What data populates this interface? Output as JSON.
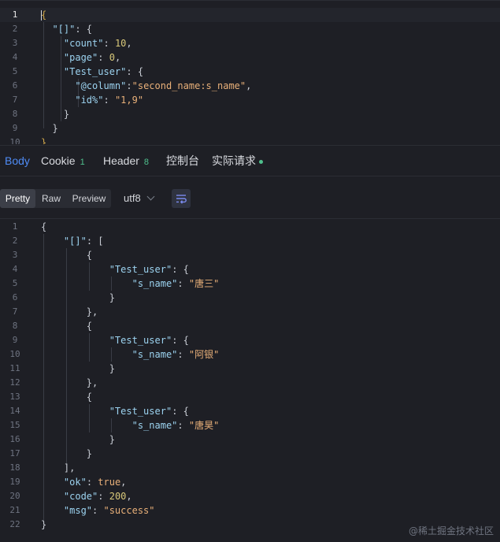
{
  "request_editor": {
    "line_numbers": [
      "1",
      "2",
      "3",
      "4",
      "5",
      "6",
      "7",
      "8",
      "9",
      "10"
    ],
    "lines": [
      {
        "tokens": [
          {
            "t": "{",
            "c": "b"
          }
        ]
      },
      {
        "tokens": [
          {
            "t": "  "
          },
          {
            "t": "\"[]\"",
            "c": "k"
          },
          {
            "t": ": {",
            "c": "p"
          }
        ]
      },
      {
        "tokens": [
          {
            "t": "    "
          },
          {
            "t": "\"count\"",
            "c": "k"
          },
          {
            "t": ": ",
            "c": "p"
          },
          {
            "t": "10",
            "c": "n"
          },
          {
            "t": ",",
            "c": "p"
          }
        ]
      },
      {
        "tokens": [
          {
            "t": "    "
          },
          {
            "t": "\"page\"",
            "c": "k"
          },
          {
            "t": ": ",
            "c": "p"
          },
          {
            "t": "0",
            "c": "n"
          },
          {
            "t": ",",
            "c": "p"
          }
        ]
      },
      {
        "tokens": [
          {
            "t": "    "
          },
          {
            "t": "\"Test_user\"",
            "c": "k"
          },
          {
            "t": ": {",
            "c": "p"
          }
        ]
      },
      {
        "tokens": [
          {
            "t": "      "
          },
          {
            "t": "\"@column\"",
            "c": "k"
          },
          {
            "t": ":",
            "c": "p"
          },
          {
            "t": "\"second_name:s_name\"",
            "c": "s"
          },
          {
            "t": ",",
            "c": "p"
          }
        ]
      },
      {
        "tokens": [
          {
            "t": "      "
          },
          {
            "t": "\"id%\"",
            "c": "k"
          },
          {
            "t": ": ",
            "c": "p"
          },
          {
            "t": "\"1,9\"",
            "c": "s"
          }
        ]
      },
      {
        "tokens": [
          {
            "t": "    "
          },
          {
            "t": "}",
            "c": "p"
          }
        ]
      },
      {
        "tokens": [
          {
            "t": "  "
          },
          {
            "t": "}",
            "c": "p"
          }
        ]
      },
      {
        "tokens": [
          {
            "t": "}",
            "c": "b"
          }
        ]
      }
    ]
  },
  "tabs": [
    {
      "label": "Body",
      "badge": "",
      "dot": false,
      "active": true
    },
    {
      "label": "Cookie",
      "badge": "1",
      "dot": false,
      "active": false
    },
    {
      "label": "Header",
      "badge": "8",
      "dot": false,
      "active": false
    },
    {
      "label": "控制台",
      "badge": "",
      "dot": false,
      "active": false
    },
    {
      "label": "实际请求",
      "badge": "",
      "dot": true,
      "active": false
    }
  ],
  "toolbar": {
    "modes": [
      "Pretty",
      "Raw",
      "Preview"
    ],
    "active_mode": "Pretty",
    "encoding": "utf8",
    "wrap_icon": "wrap-lines-icon"
  },
  "response": {
    "line_numbers": [
      "1",
      "2",
      "3",
      "4",
      "5",
      "6",
      "7",
      "8",
      "9",
      "10",
      "11",
      "12",
      "13",
      "14",
      "15",
      "16",
      "17",
      "18",
      "19",
      "20",
      "21",
      "22"
    ],
    "lines": [
      {
        "tokens": [
          {
            "t": "{",
            "c": "p"
          }
        ]
      },
      {
        "tokens": [
          {
            "t": "    "
          },
          {
            "t": "\"[]\"",
            "c": "k"
          },
          {
            "t": ": [",
            "c": "p"
          }
        ]
      },
      {
        "tokens": [
          {
            "t": "        "
          },
          {
            "t": "{",
            "c": "p"
          }
        ]
      },
      {
        "tokens": [
          {
            "t": "            "
          },
          {
            "t": "\"Test_user\"",
            "c": "k"
          },
          {
            "t": ": {",
            "c": "p"
          }
        ]
      },
      {
        "tokens": [
          {
            "t": "                "
          },
          {
            "t": "\"s_name\"",
            "c": "k"
          },
          {
            "t": ": ",
            "c": "p"
          },
          {
            "t": "\"唐三\"",
            "c": "s"
          }
        ]
      },
      {
        "tokens": [
          {
            "t": "            "
          },
          {
            "t": "}",
            "c": "p"
          }
        ]
      },
      {
        "tokens": [
          {
            "t": "        "
          },
          {
            "t": "},",
            "c": "p"
          }
        ]
      },
      {
        "tokens": [
          {
            "t": "        "
          },
          {
            "t": "{",
            "c": "p"
          }
        ]
      },
      {
        "tokens": [
          {
            "t": "            "
          },
          {
            "t": "\"Test_user\"",
            "c": "k"
          },
          {
            "t": ": {",
            "c": "p"
          }
        ]
      },
      {
        "tokens": [
          {
            "t": "                "
          },
          {
            "t": "\"s_name\"",
            "c": "k"
          },
          {
            "t": ": ",
            "c": "p"
          },
          {
            "t": "\"阿银\"",
            "c": "s"
          }
        ]
      },
      {
        "tokens": [
          {
            "t": "            "
          },
          {
            "t": "}",
            "c": "p"
          }
        ]
      },
      {
        "tokens": [
          {
            "t": "        "
          },
          {
            "t": "},",
            "c": "p"
          }
        ]
      },
      {
        "tokens": [
          {
            "t": "        "
          },
          {
            "t": "{",
            "c": "p"
          }
        ]
      },
      {
        "tokens": [
          {
            "t": "            "
          },
          {
            "t": "\"Test_user\"",
            "c": "k"
          },
          {
            "t": ": {",
            "c": "p"
          }
        ]
      },
      {
        "tokens": [
          {
            "t": "                "
          },
          {
            "t": "\"s_name\"",
            "c": "k"
          },
          {
            "t": ": ",
            "c": "p"
          },
          {
            "t": "\"唐昊\"",
            "c": "s"
          }
        ]
      },
      {
        "tokens": [
          {
            "t": "            "
          },
          {
            "t": "}",
            "c": "p"
          }
        ]
      },
      {
        "tokens": [
          {
            "t": "        "
          },
          {
            "t": "}",
            "c": "p"
          }
        ]
      },
      {
        "tokens": [
          {
            "t": "    "
          },
          {
            "t": "],",
            "c": "p"
          }
        ]
      },
      {
        "tokens": [
          {
            "t": "    "
          },
          {
            "t": "\"ok\"",
            "c": "k"
          },
          {
            "t": ": ",
            "c": "p"
          },
          {
            "t": "true",
            "c": "kw"
          },
          {
            "t": ",",
            "c": "p"
          }
        ]
      },
      {
        "tokens": [
          {
            "t": "    "
          },
          {
            "t": "\"code\"",
            "c": "k"
          },
          {
            "t": ": ",
            "c": "p"
          },
          {
            "t": "200",
            "c": "n"
          },
          {
            "t": ",",
            "c": "p"
          }
        ]
      },
      {
        "tokens": [
          {
            "t": "    "
          },
          {
            "t": "\"msg\"",
            "c": "k"
          },
          {
            "t": ": ",
            "c": "p"
          },
          {
            "t": "\"success\"",
            "c": "s"
          }
        ]
      },
      {
        "tokens": [
          {
            "t": "}",
            "c": "p"
          }
        ]
      }
    ]
  },
  "watermark": "@稀土掘金技术社区",
  "colors": {
    "background": "#1e1f25",
    "accent": "#4f8cf6",
    "key": "#9cd3f0",
    "string": "#e9b079",
    "number": "#d9c97a",
    "badge": "#4fc08d"
  }
}
